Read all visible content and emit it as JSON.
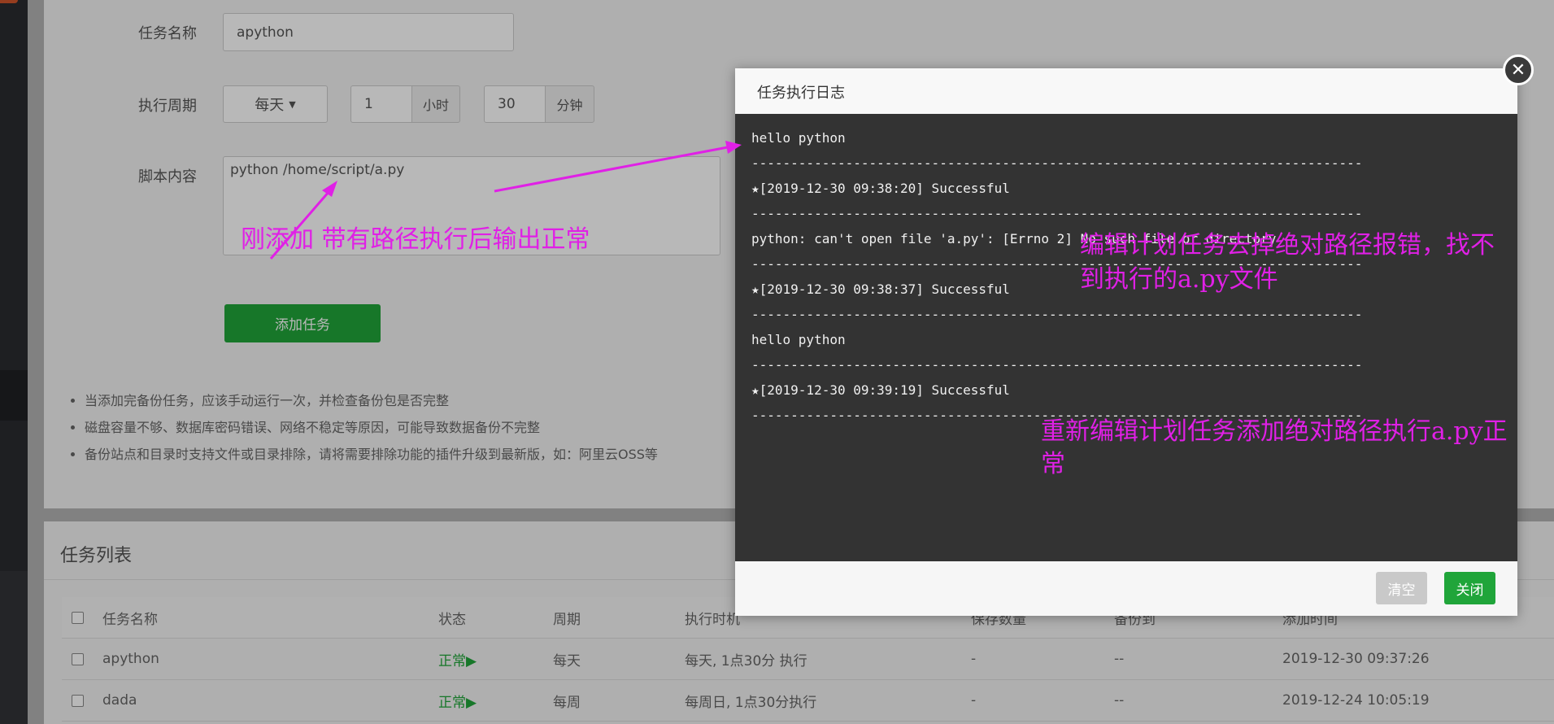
{
  "form": {
    "task_name_label": "任务名称",
    "task_name_value": "apython",
    "cycle_label": "执行周期",
    "cycle_select": "每天",
    "hour_value": "1",
    "hour_unit": "小时",
    "minute_value": "30",
    "minute_unit": "分钟",
    "script_label": "脚本内容",
    "script_value": "python  /home/script/a.py",
    "add_button": "添加任务"
  },
  "tips": [
    "当添加完备份任务，应该手动运行一次，并检查备份包是否完整",
    "磁盘容量不够、数据库密码错误、网络不稳定等原因，可能导致数据备份不完整",
    "备份站点和目录时支持文件或目录排除，请将需要排除功能的插件升级到最新版，如：阿里云OSS等"
  ],
  "task_list": {
    "title": "任务列表",
    "columns": [
      "任务名称",
      "状态",
      "周期",
      "执行时机",
      "保存数量",
      "备份到",
      "添加时间"
    ],
    "rows": [
      {
        "name": "apython",
        "status": "正常▶",
        "cycle": "每天",
        "timing": "每天, 1点30分 执行",
        "keep": "-",
        "backup_to": "--",
        "added": "2019-12-30 09:37:26"
      },
      {
        "name": "dada",
        "status": "正常▶",
        "cycle": "每周",
        "timing": "每周日, 1点30分执行",
        "keep": "-",
        "backup_to": "--",
        "added": "2019-12-24 10:05:19"
      }
    ]
  },
  "modal": {
    "title": "任务执行日志",
    "close_symbol": "✕",
    "log_lines": [
      "hello python",
      "------------------------------------------------------------------------------",
      "★[2019-12-30 09:38:20] Successful",
      "------------------------------------------------------------------------------",
      "python: can't open file 'a.py': [Errno 2] No such file or directory",
      "------------------------------------------------------------------------------",
      "★[2019-12-30 09:38:37] Successful",
      "------------------------------------------------------------------------------",
      "hello python",
      "------------------------------------------------------------------------------",
      "★[2019-12-30 09:39:19] Successful",
      "------------------------------------------------------------------------------"
    ],
    "clear_button": "清空",
    "close_button": "关闭"
  },
  "annotations": {
    "note_1": "刚添加 带有路径执行后输出正常",
    "note_2_line1": "编辑计划任务去掉绝对路径报错，找不",
    "note_2_line2": "到执行的a.py文件",
    "note_3_line1": "重新编辑计划任务添加绝对路径执行a.py正",
    "note_3_line2": "常",
    "color": "#e020e6"
  },
  "colors": {
    "accent_green": "#20a53a",
    "log_background": "#333333"
  }
}
